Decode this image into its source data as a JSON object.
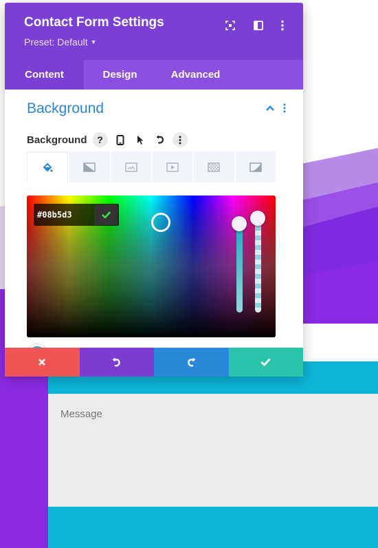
{
  "modal": {
    "title": "Contact Form Settings",
    "preset_label": "Preset: Default",
    "header_icons": [
      "expand-icon",
      "split-view-icon",
      "more-vertical-icon"
    ],
    "tabs": [
      {
        "label": "Content",
        "active": true
      },
      {
        "label": "Design",
        "active": false
      },
      {
        "label": "Advanced",
        "active": false
      }
    ]
  },
  "section": {
    "title": "Background",
    "field_label": "Background",
    "help_glyph": "?",
    "label_icons": [
      "help-icon",
      "device-icon",
      "hover-cursor-icon",
      "reset-icon",
      "more-vertical-icon"
    ],
    "bg_type_tabs": [
      {
        "name": "color-fill-icon",
        "active": true
      },
      {
        "name": "gradient-icon",
        "active": false
      },
      {
        "name": "image-icon",
        "active": false
      },
      {
        "name": "video-icon",
        "active": false
      },
      {
        "name": "pattern-icon",
        "active": false
      },
      {
        "name": "mask-icon",
        "active": false
      }
    ]
  },
  "color_picker": {
    "hex_value": "#08b5d3",
    "selected_color": "#08b5d3"
  },
  "actions": [
    {
      "name": "discard-button",
      "icon": "close-icon",
      "color": "#ef5555"
    },
    {
      "name": "undo-button",
      "icon": "undo-icon",
      "color": "#7e3bd0"
    },
    {
      "name": "redo-button",
      "icon": "redo-icon",
      "color": "#2b87da"
    },
    {
      "name": "save-button",
      "icon": "check-icon",
      "color": "#29c4a9"
    }
  ],
  "form": {
    "message_placeholder": "Message"
  },
  "colors": {
    "header_purple": "#7b3fd4",
    "tab_bar_purple": "#8c4fe2",
    "section_blue": "#2b87da",
    "page_cyan": "#0cb5d6",
    "page_purple": "#8a2be2"
  }
}
